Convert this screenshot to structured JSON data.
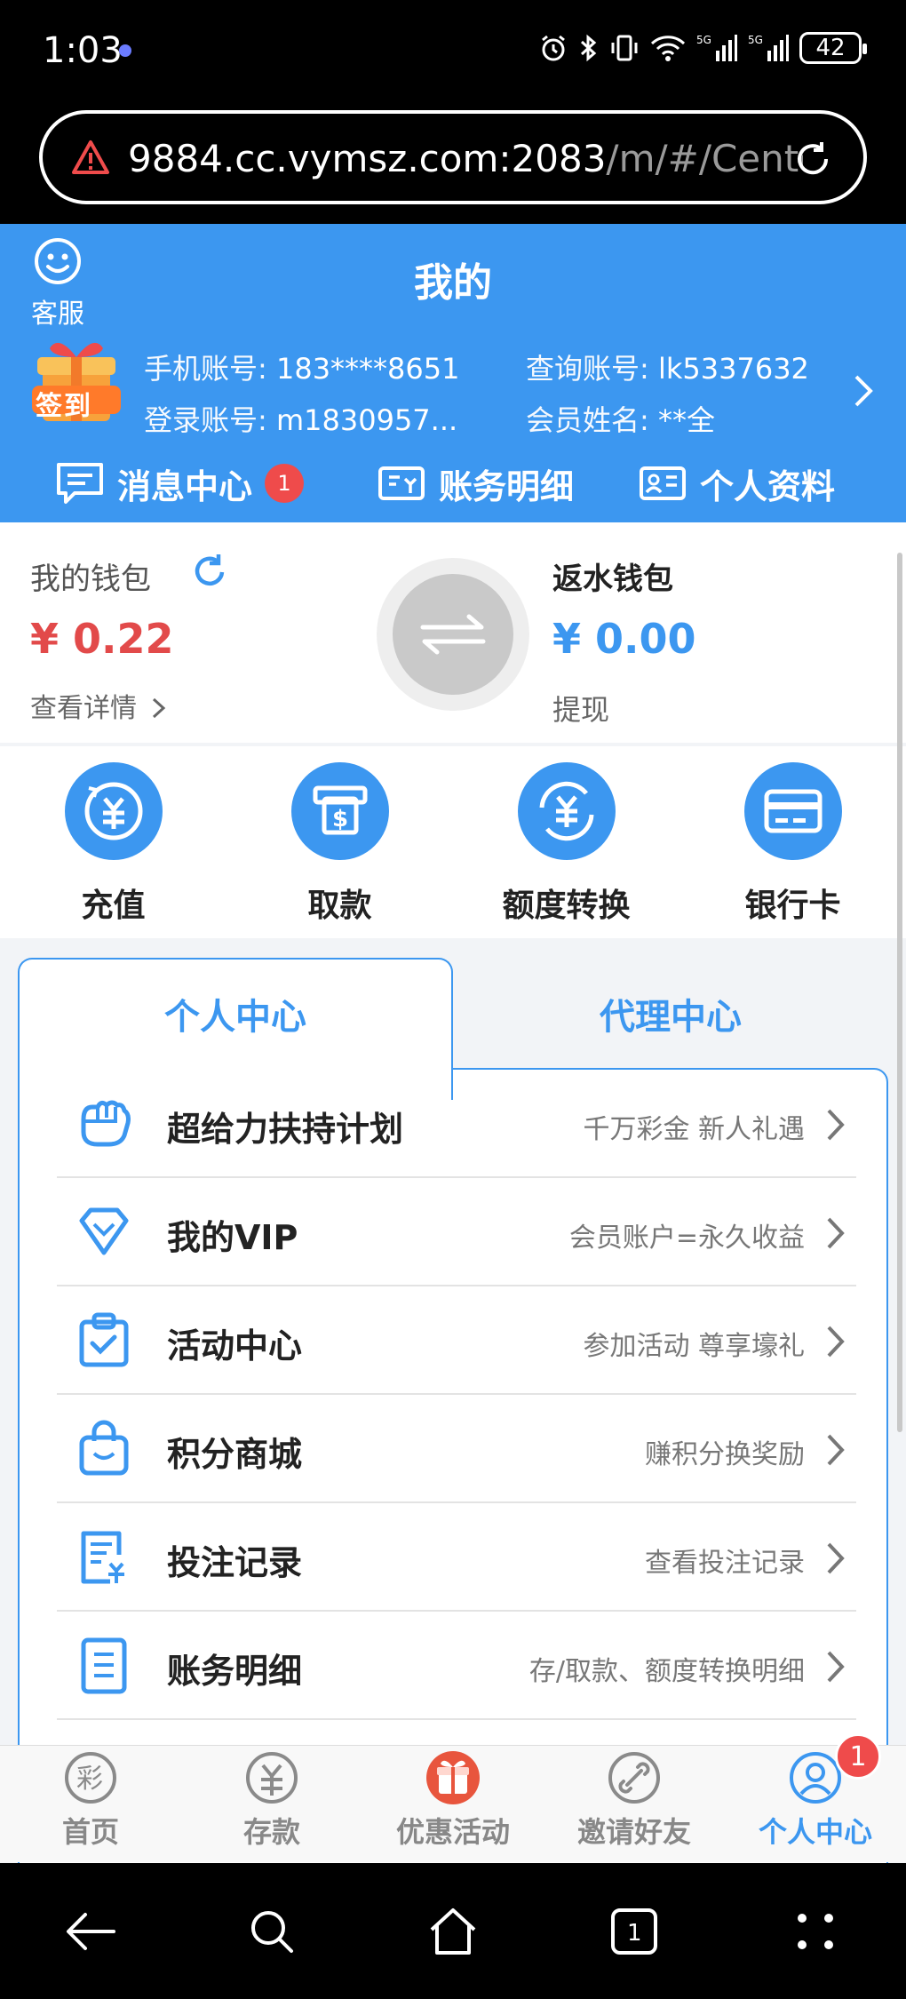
{
  "status_bar": {
    "time": "1:03",
    "battery": "42",
    "network_labels": [
      "5G",
      "5G"
    ]
  },
  "browser": {
    "url_host": "9884.cc.vymsz.com:2083",
    "url_path": "/m/#/Center"
  },
  "header": {
    "service_label": "客服",
    "title": "我的",
    "gift_text": "签到",
    "phone_label": "手机账号:",
    "phone_value": "183****8651",
    "query_label": "查询账号:",
    "query_value": "lk5337632",
    "login_label": "登录账号:",
    "login_value": "m1830957...",
    "member_label": "会员姓名:",
    "member_value": "**全",
    "quick_links": [
      {
        "label": "消息中心",
        "badge": "1"
      },
      {
        "label": "账务明细"
      },
      {
        "label": "个人资料"
      }
    ]
  },
  "wallet": {
    "my_wallet_label": "我的钱包",
    "my_wallet_amount": "¥ 0.22",
    "details_link": "查看详情",
    "rebate_label": "返水钱包",
    "rebate_amount": "¥ 0.00",
    "withdraw_link": "提现"
  },
  "actions": [
    {
      "label": "充值",
      "icon": "yuan-coin-icon"
    },
    {
      "label": "取款",
      "icon": "atm-icon"
    },
    {
      "label": "额度转换",
      "icon": "exchange-yuan-icon"
    },
    {
      "label": "银行卡",
      "icon": "bank-card-icon"
    }
  ],
  "tabs": {
    "personal": "个人中心",
    "agent": "代理中心"
  },
  "menu": [
    {
      "label": "超给力扶持计划",
      "sub": "千万彩金 新人礼遇",
      "icon": "fist-icon"
    },
    {
      "label": "我的VIP",
      "sub": "会员账户=永久收益",
      "icon": "diamond-icon"
    },
    {
      "label": "活动中心",
      "sub": "参加活动 尊享壕礼",
      "icon": "clipboard-check-icon"
    },
    {
      "label": "积分商城",
      "sub": "赚积分换奖励",
      "icon": "shopping-bag-icon"
    },
    {
      "label": "投注记录",
      "sub": "查看投注记录",
      "icon": "bet-record-icon"
    },
    {
      "label": "账务明细",
      "sub": "存/取款、额度转换明细",
      "icon": "ledger-icon"
    }
  ],
  "bottom_nav": [
    {
      "label": "首页",
      "icon": "lottery-icon"
    },
    {
      "label": "存款",
      "icon": "deposit-icon"
    },
    {
      "label": "优惠活动",
      "icon": "gift-box-icon"
    },
    {
      "label": "邀请好友",
      "icon": "link-icon"
    },
    {
      "label": "个人中心",
      "icon": "user-icon",
      "badge": "1"
    }
  ],
  "colors": {
    "primary": "#3c97f0",
    "danger": "#ef4b4b",
    "amount_red": "#e24a4a"
  }
}
